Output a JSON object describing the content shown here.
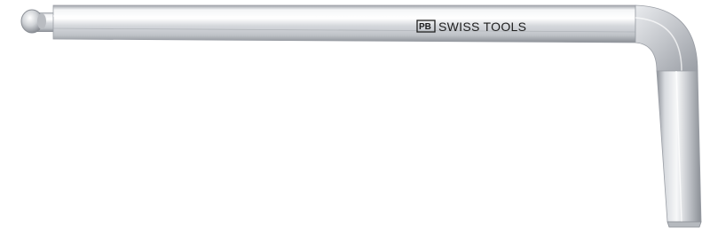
{
  "product": {
    "logo_letters": "PB",
    "brand_name": "SWISS TOOLS"
  },
  "colors": {
    "background": "#ffffff",
    "steel_light": "#f2f3f5",
    "steel_mid": "#c9ccd1",
    "steel_dark": "#8e9299",
    "logo_ink": "#1e1e1e"
  },
  "icons": {
    "tool": "ball-end-hex-key-icon",
    "logo": "pb-logo-icon"
  }
}
